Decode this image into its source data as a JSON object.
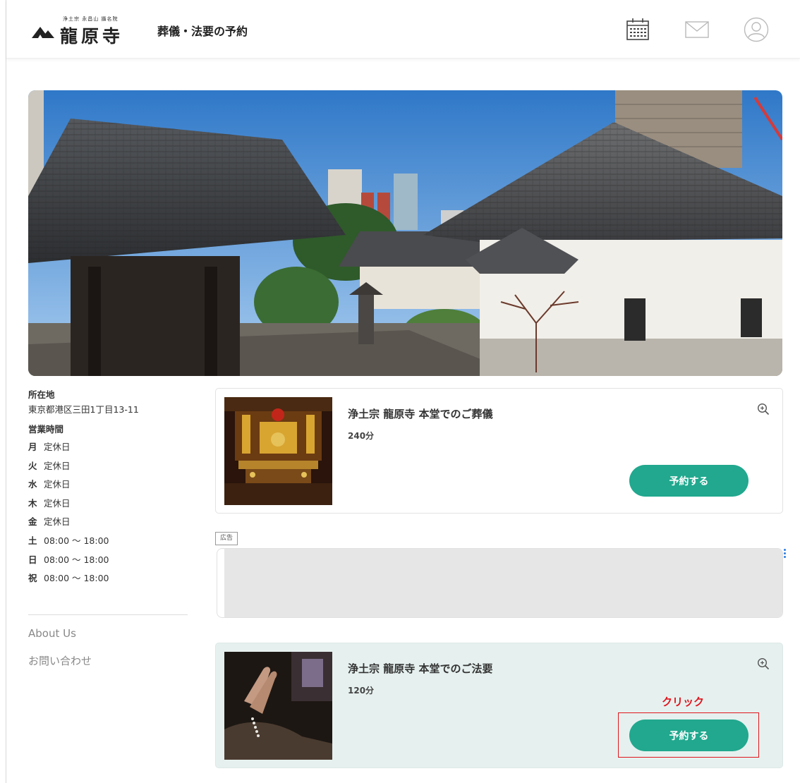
{
  "header": {
    "logo_small": "浄土宗 永昌山 攝名院",
    "logo_name": "龍原寺",
    "title": "葬儀・法要の予約",
    "icons": [
      "calendar-icon",
      "mail-icon",
      "user-icon"
    ]
  },
  "sidebar": {
    "location_label": "所在地",
    "address": "東京都港区三田1丁目13-11",
    "hours_label": "営業時間",
    "hours": [
      {
        "day": "月",
        "time": "定休日"
      },
      {
        "day": "火",
        "time": "定休日"
      },
      {
        "day": "水",
        "time": "定休日"
      },
      {
        "day": "木",
        "time": "定休日"
      },
      {
        "day": "金",
        "time": "定休日"
      },
      {
        "day": "土",
        "time": "08:00 〜 18:00"
      },
      {
        "day": "日",
        "time": "08:00 〜 18:00"
      },
      {
        "day": "祝",
        "time": "08:00 〜 18:00"
      }
    ],
    "links": [
      "About Us",
      "お問い合わせ"
    ]
  },
  "services": [
    {
      "title": "浄土宗 龍原寺 本堂でのご葬儀",
      "duration": "240分",
      "button": "予約する"
    },
    {
      "title": "浄土宗 龍原寺 本堂でのご法要",
      "duration": "120分",
      "button": "予約する"
    }
  ],
  "ad": {
    "label": "広告"
  },
  "annotation": {
    "text": "クリック"
  },
  "colors": {
    "accent": "#21a88e",
    "annotation": "#e0141c",
    "highlight_card": "#e6f1ef"
  }
}
